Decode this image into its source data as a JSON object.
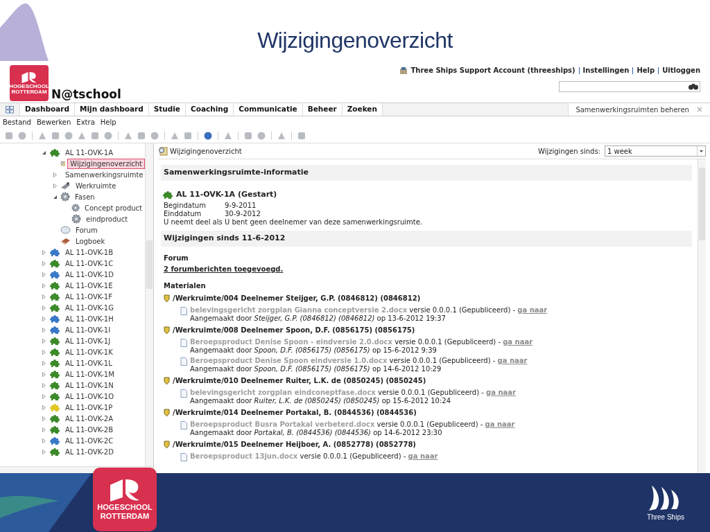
{
  "slide": {
    "title": "Wijzigingenoverzicht",
    "footer_logo": [
      "HOGESCHOOL",
      "ROTTERDAM"
    ],
    "footer_brand": "Three Ships"
  },
  "app": {
    "logo": [
      "HOGESCHOOL",
      "ROTTERDAM"
    ],
    "name": "N@tschool",
    "account_links": [
      {
        "label": "Three Ships Support Account (threeships)"
      },
      {
        "label": "Instellingen"
      },
      {
        "label": "Help"
      },
      {
        "label": "Uitloggen"
      }
    ],
    "nav_tabs": [
      {
        "label": "Dashboard"
      },
      {
        "label": "Mijn dashboard"
      },
      {
        "label": "Studie"
      },
      {
        "label": "Coaching"
      },
      {
        "label": "Communicatie"
      },
      {
        "label": "Beheer"
      },
      {
        "label": "Zoeken"
      }
    ],
    "open_tab": {
      "label": "Samenwerkingsruimten beheren",
      "close": "×"
    },
    "menu": [
      "Bestand",
      "Bewerken",
      "Extra",
      "Help"
    ],
    "tree": [
      {
        "label": "AL 11-OVK-1A",
        "kind": "space",
        "color": "#3c8a2a",
        "expanded": true,
        "children": [
          {
            "label": "Wijzigingenoverzicht",
            "kind": "changes",
            "selected": true
          },
          {
            "label": "Samenwerkingsruimte",
            "kind": "people",
            "selected": false,
            "expanded": false
          },
          {
            "label": "Werkruimte",
            "kind": "workspace",
            "selected": false,
            "expanded": false
          },
          {
            "label": "Fasen",
            "kind": "gear",
            "selected": false,
            "expanded": true,
            "children": [
              {
                "label": "Concept product",
                "kind": "gear",
                "selected": false
              },
              {
                "label": "eindproduct",
                "kind": "gear",
                "selected": false
              }
            ]
          },
          {
            "label": "Forum",
            "kind": "forum",
            "selected": false
          },
          {
            "label": "Logboek",
            "kind": "book",
            "selected": false
          }
        ]
      },
      {
        "label": "AL 11-OVK-1B",
        "kind": "space",
        "color": "#3a78c8",
        "expanded": false
      },
      {
        "label": "AL 11-OVK-1C",
        "kind": "space",
        "color": "#3c8a2a",
        "expanded": false
      },
      {
        "label": "AL 11-OVK-1D",
        "kind": "space",
        "color": "#3a78c8",
        "expanded": false
      },
      {
        "label": "AL 11-OVK-1E",
        "kind": "space",
        "color": "#3c8a2a",
        "expanded": false
      },
      {
        "label": "AL 11-OVK-1F",
        "kind": "space",
        "color": "#3c8a2a",
        "expanded": false
      },
      {
        "label": "AL 11-OVK-1G",
        "kind": "space",
        "color": "#3c8a2a",
        "expanded": false
      },
      {
        "label": "AL 11-OVK-1H",
        "kind": "space",
        "color": "#3a78c8",
        "expanded": false
      },
      {
        "label": "AL 11-OVK-1I",
        "kind": "space",
        "color": "#3a78c8",
        "expanded": false
      },
      {
        "label": "AL 11-OVK-1J",
        "kind": "space",
        "color": "#3c8a2a",
        "expanded": false
      },
      {
        "label": "AL 11-OVK-1K",
        "kind": "space",
        "color": "#3c8a2a",
        "expanded": false
      },
      {
        "label": "AL 11-OVK-1L",
        "kind": "space",
        "color": "#3c8a2a",
        "expanded": false
      },
      {
        "label": "AL 11-OVK-1M",
        "kind": "space",
        "color": "#3c8a2a",
        "expanded": false
      },
      {
        "label": "AL 11-OVK-1N",
        "kind": "space",
        "color": "#3c8a2a",
        "expanded": false
      },
      {
        "label": "AL 11-OVK-1O",
        "kind": "space",
        "color": "#3c8a2a",
        "expanded": false
      },
      {
        "label": "AL 11-OVK-1P",
        "kind": "space",
        "color": "#e0c828",
        "expanded": false
      },
      {
        "label": "AL 11-OVK-2A",
        "kind": "space",
        "color": "#3c8a2a",
        "expanded": false
      },
      {
        "label": "AL 11-OVK-2B",
        "kind": "space",
        "color": "#3c8a2a",
        "expanded": false
      },
      {
        "label": "AL 11-OVK-2C",
        "kind": "space",
        "color": "#3a78c8",
        "expanded": false
      },
      {
        "label": "AL 11-OVK-2D",
        "kind": "space",
        "color": "#3c8a2a",
        "expanded": false
      }
    ],
    "content": {
      "page_title": "Wijzigingenoverzicht",
      "since_label": "Wijzigingen sinds:",
      "since_value": "1 week",
      "info_heading": "Samenwerkingsruimte-informatie",
      "space_title": "AL 11-OVK-1A (Gestart)",
      "info_rows": [
        {
          "label": "Begindatum",
          "value": "9-9-2011"
        },
        {
          "label": "Einddatum",
          "value": "30-9-2012"
        },
        {
          "label": "U neemt deel als",
          "value": "U bent geen deelnemer van deze samenwerkingsruimte."
        }
      ],
      "changes_heading": "Wijzigingen sinds 11-6-2012",
      "forum_heading": "Forum",
      "forum_link": "2 forumberichten toegevoegd.",
      "materials_heading": "Materialen",
      "folders": [
        {
          "path": "/Werkruimte/004 Deelnemer Steijger, G.P. (0846812) (0846812)",
          "files": [
            {
              "name": "belevingsgericht zorgplan Gianna conceptversie 2.docx",
              "info": " versie 0.0.0.1 (Gepubliceerd) - ",
              "link": "ga naar",
              "created": "Aangemaakt door *Steijger, G.P. (0846812) (0846812)* op 13-6-2012 19:37"
            }
          ]
        },
        {
          "path": "/Werkruimte/008 Deelnemer Spoon, D.F. (0856175) (0856175)",
          "files": [
            {
              "name": "Beroepsproduct Denise Spoon - eindversie 2.0.docx",
              "info": " versie 0.0.0.1 (Gepubliceerd) - ",
              "link": "ga naar",
              "created": "Aangemaakt door *Spoon, D.F. (0856175) (0856175)* op 15-6-2012 9:39"
            },
            {
              "name": "Beroepsproduct Denise Spoon eindversie 1.0.docx",
              "info": " versie 0.0.0.1 (Gepubliceerd) - ",
              "link": "ga naar",
              "created": "Aangemaakt door *Spoon, D.F. (0856175) (0856175)* op 14-6-2012 10:29"
            }
          ]
        },
        {
          "path": "/Werkruimte/010 Deelnemer Ruiter, L.K. de (0850245) (0850245)",
          "files": [
            {
              "name": "belevingsgericht zorgplan eindconeptfase.docx",
              "info": " versie 0.0.0.1 (Gepubliceerd) - ",
              "link": "ga naar",
              "created": "Aangemaakt door *Ruiter, L.K. de (0850245) (0850245)* op 15-6-2012 10:24"
            }
          ]
        },
        {
          "path": "/Werkruimte/014 Deelnemer Portakal, B. (0844536) (0844536)",
          "files": [
            {
              "name": "Beroepsproduct Busra Portakal verbeterd.docx",
              "info": " versie 0.0.0.1 (Gepubliceerd) - ",
              "link": "ga naar",
              "created": "Aangemaakt door *Portakal, B. (0844536) (0844536)* op 14-6-2012 23:30"
            }
          ]
        },
        {
          "path": "/Werkruimte/015 Deelnemer Heijboer, A. (0852778) (0852778)",
          "files": [
            {
              "name": "Beroepsproduct 13jun.docx",
              "info": " versie 0.0.0.1 (Gepubliceerd) - ",
              "link": "ga naar"
            }
          ]
        }
      ]
    }
  }
}
